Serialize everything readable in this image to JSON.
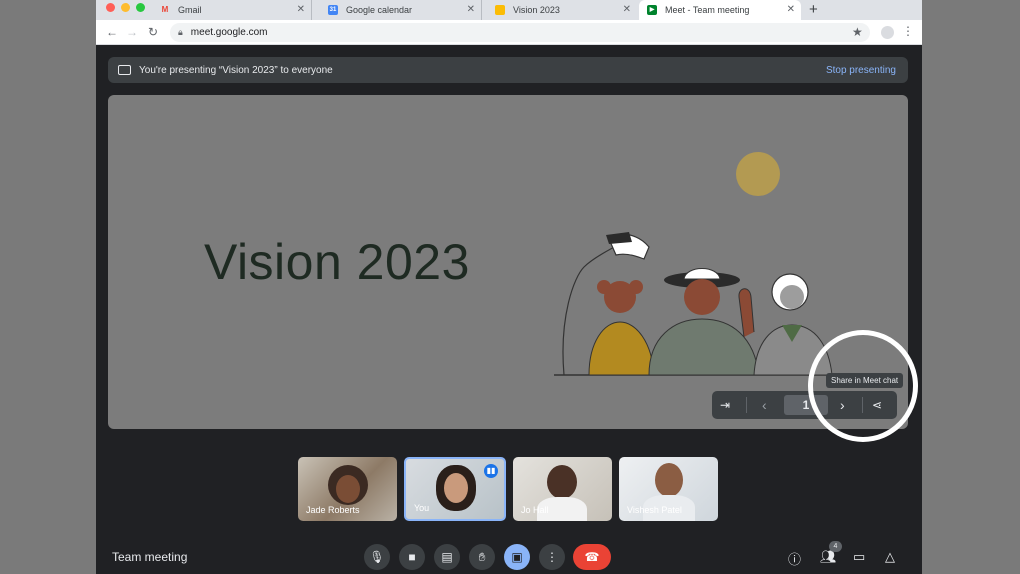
{
  "browser": {
    "tabs": [
      {
        "title": "Gmail",
        "icon": "gmail-icon"
      },
      {
        "title": "Google calendar",
        "icon": "calendar-icon"
      },
      {
        "title": "Vision 2023",
        "icon": "slides-icon"
      },
      {
        "title": "Meet - Team meeting",
        "icon": "meet-icon"
      }
    ],
    "url": "meet.google.com"
  },
  "banner": {
    "text": "You're presenting “Vision 2023” to everyone",
    "stop_label": "Stop presenting"
  },
  "slide": {
    "title": "Vision 2023",
    "page": "1"
  },
  "tooltip": "Share in Meet chat",
  "participants": [
    {
      "name": "Jade Roberts"
    },
    {
      "name": "You"
    },
    {
      "name": "Jo Hall"
    },
    {
      "name": "Vishesh Patel"
    }
  ],
  "meeting": {
    "title": "Team meeting",
    "people_count": "4"
  },
  "colors": {
    "accent": "#8ab4f8",
    "leave": "#ea4335",
    "background": "#202124"
  }
}
